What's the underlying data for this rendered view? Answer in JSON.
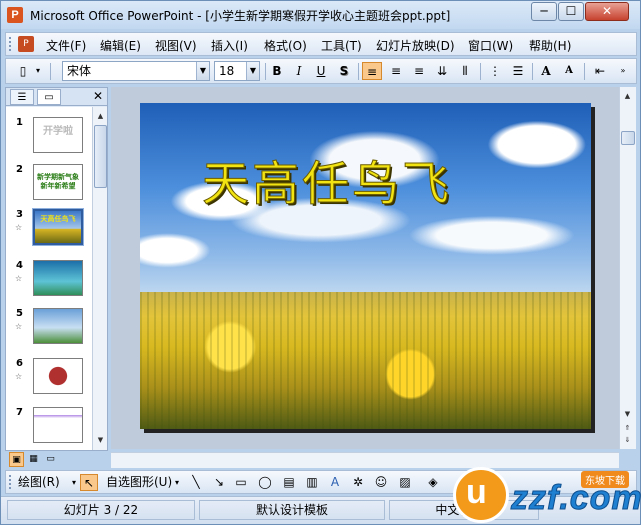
{
  "window": {
    "title": "Microsoft Office PowerPoint - [小学生新学期寒假开学收心主题班会ppt.ppt]",
    "min_label": "─",
    "max_label": "☐",
    "close_label": "✕"
  },
  "menu": {
    "items": [
      "文件(F)",
      "编辑(E)",
      "视图(V)",
      "插入(I)",
      "格式(O)",
      "工具(T)",
      "幻灯片放映(D)",
      "窗口(W)",
      "帮助(H)"
    ]
  },
  "toolbar": {
    "font_name": "宋体",
    "font_size": "18",
    "bold": "B",
    "italic": "I",
    "underline": "U",
    "shadow": "S",
    "grow_font": "A",
    "shrink_font": "A"
  },
  "slides_panel": {
    "tab_outline": "☰",
    "tab_slides": "▭",
    "close": "✕",
    "slides": [
      {
        "number": "1",
        "thumb_text": "开学啦",
        "has_anim": false
      },
      {
        "number": "2",
        "thumb_text": "新学期新气象 新年新希望",
        "has_anim": false
      },
      {
        "number": "3",
        "thumb_text": "天高任鸟飞",
        "has_anim": true,
        "selected": true
      },
      {
        "number": "4",
        "thumb_text": "",
        "has_anim": true
      },
      {
        "number": "5",
        "thumb_text": "",
        "has_anim": true
      },
      {
        "number": "6",
        "thumb_text": "",
        "has_anim": true
      },
      {
        "number": "7",
        "thumb_text": "",
        "has_anim": false
      }
    ]
  },
  "slide": {
    "title": "天高任鸟飞"
  },
  "drawbar": {
    "draw_label": "绘图(R)",
    "autoshape_label": "自选图形(U)"
  },
  "status": {
    "slide_info": "幻灯片 3 / 22",
    "design": "默认设计模板",
    "language": "中文(中国)"
  },
  "watermark": {
    "logo_text": "uzzf.com",
    "tag": "东坡下载"
  },
  "colors": {
    "accent_active": "#f9c88a",
    "title_yellow": "#f2e313",
    "titlebar_close": "#c7422f"
  }
}
